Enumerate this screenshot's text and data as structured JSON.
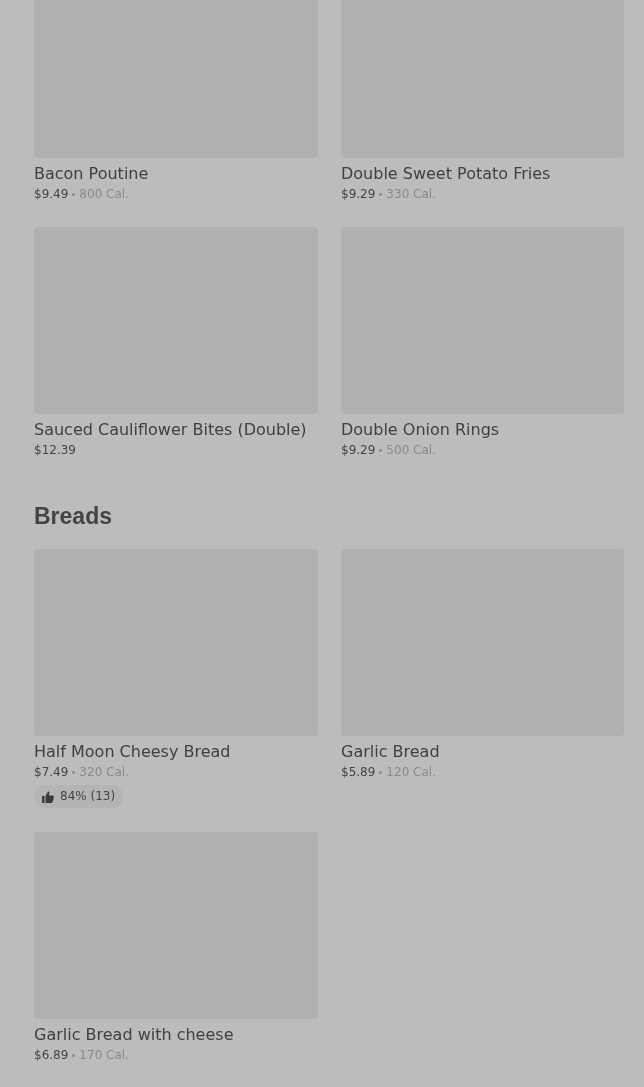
{
  "sections": [
    {
      "items": [
        {
          "name": "Bacon Poutine",
          "price": "$9.49",
          "calories": "800 Cal."
        },
        {
          "name": "Double Sweet Potato Fries",
          "price": "$9.29",
          "calories": "330 Cal."
        },
        {
          "name": "Sauced Cauliflower Bites (Double)",
          "price": "$12.39"
        },
        {
          "name": "Double Onion Rings",
          "price": "$9.29",
          "calories": "500 Cal."
        }
      ]
    },
    {
      "title": "Breads",
      "items": [
        {
          "name": "Half Moon Cheesy Bread",
          "price": "$7.49",
          "calories": "320 Cal.",
          "rating": "84% (13)"
        },
        {
          "name": "Garlic Bread",
          "price": "$5.89",
          "calories": "120 Cal."
        },
        {
          "name": "Garlic Bread with cheese",
          "price": "$6.89",
          "calories": "170 Cal."
        }
      ]
    }
  ]
}
